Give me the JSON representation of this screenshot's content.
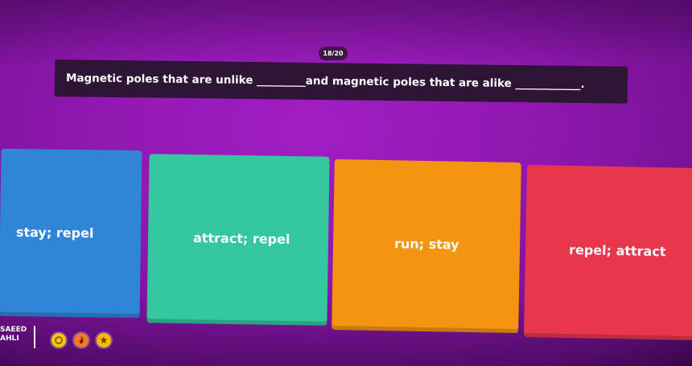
{
  "quiz": {
    "counter": "18/20",
    "question": "Magnetic poles that are unlike _________and magnetic poles that are alike ____________."
  },
  "answers": [
    {
      "label": "stay; repel",
      "color": "#2f86d9"
    },
    {
      "label": "attract; repel",
      "color": "#34c7a0"
    },
    {
      "label": "run; stay",
      "color": "#f49512"
    },
    {
      "label": "repel; attract",
      "color": "#e8374d"
    }
  ],
  "player": {
    "first_name": "SAEED",
    "last_name": "AHLI"
  },
  "powerups": [
    {
      "icon": "coin-icon",
      "color": "#f2c500"
    },
    {
      "icon": "fire-icon",
      "color": "#f07a2a"
    },
    {
      "icon": "star-icon",
      "color": "#f6b800"
    }
  ]
}
